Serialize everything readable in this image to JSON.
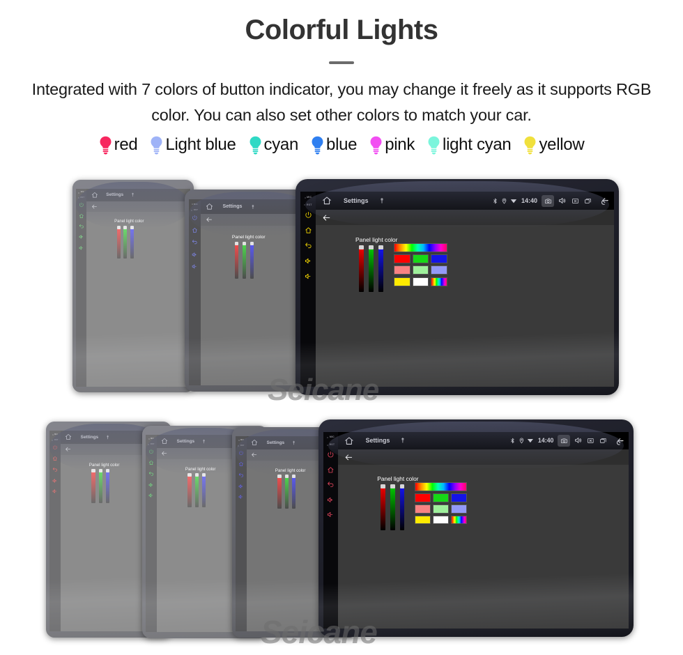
{
  "header": {
    "title": "Colorful Lights",
    "subtitle": "Integrated with 7 colors of button indicator, you may change it freely as it supports RGB color. You can also set other colors to match your car.",
    "divider_color": "#6b6b6b",
    "title_color": "#333333"
  },
  "legend": {
    "items": [
      {
        "label": "red",
        "color": "#f7275f",
        "icon": "bulb-icon"
      },
      {
        "label": "Light blue",
        "color": "#9fb3f7",
        "icon": "bulb-icon"
      },
      {
        "label": "cyan",
        "color": "#2fd9c5",
        "icon": "bulb-icon"
      },
      {
        "label": "blue",
        "color": "#2f7ff0",
        "icon": "bulb-icon"
      },
      {
        "label": "pink",
        "color": "#f24ef2",
        "icon": "bulb-icon"
      },
      {
        "label": "light cyan",
        "color": "#7bf5dc",
        "icon": "bulb-icon"
      },
      {
        "label": "yellow",
        "color": "#f0e03c",
        "icon": "bulb-icon"
      }
    ]
  },
  "watermark": {
    "text": "Seicane"
  },
  "screen_ui": {
    "status_bar": {
      "home_icon": "home-icon",
      "title": "Settings",
      "mic_icon": "microphone-icon",
      "bluetooth_icon": "bluetooth-icon",
      "location_icon": "location-pin-icon",
      "wifi_icon": "wifi-icon",
      "clock": "14:40",
      "camera_icon": "camera-icon",
      "volume_icon": "speaker-icon",
      "close_icon": "close-box-icon",
      "recents_icon": "recent-apps-icon",
      "back_icon": "back-arrow-icon"
    },
    "action_bar": {
      "back_icon": "arrow-left-icon"
    },
    "content": {
      "panel_label": "Panel light color",
      "sliders": [
        {
          "name": "red-channel",
          "color": "#ff0000",
          "value_pct": 100
        },
        {
          "name": "green-channel",
          "color": "#00d400",
          "value_pct": 100
        },
        {
          "name": "blue-channel",
          "color": "#1414ff",
          "value_pct": 100
        }
      ],
      "swatches": [
        {
          "name": "hue-spectrum",
          "type": "hue-wide"
        },
        {
          "name": "swatch-red",
          "color": "#ff0000"
        },
        {
          "name": "swatch-green",
          "color": "#16d816"
        },
        {
          "name": "swatch-blue",
          "color": "#1414e6"
        },
        {
          "name": "swatch-light-red",
          "color": "#f98282"
        },
        {
          "name": "swatch-light-green",
          "color": "#9ef09b"
        },
        {
          "name": "swatch-light-blue",
          "color": "#9399f7"
        },
        {
          "name": "swatch-yellow",
          "color": "#ffeb00"
        },
        {
          "name": "swatch-white",
          "color": "#ffffff"
        },
        {
          "name": "swatch-rainbow",
          "type": "hue-small"
        }
      ]
    },
    "hard_keys": {
      "mic_label": "MIC",
      "rst_label": "RST",
      "keys": [
        "power-icon",
        "home-icon",
        "back-icon",
        "volume-up-icon",
        "volume-down-icon"
      ]
    }
  },
  "devices": {
    "row_top": [
      {
        "name": "device-top-1",
        "key_color": "#2ecc40",
        "key_color_name": "green"
      },
      {
        "name": "device-top-2",
        "key_color": "#4a55e8",
        "key_color_name": "blue"
      },
      {
        "name": "device-top-3",
        "key_color": "#ffe100",
        "key_color_name": "yellow"
      }
    ],
    "row_bottom": [
      {
        "name": "device-bottom-1",
        "key_color": "#e61414",
        "key_color_name": "red"
      },
      {
        "name": "device-bottom-2",
        "key_color": "#13cc2e",
        "key_color_name": "green"
      },
      {
        "name": "device-bottom-3",
        "key_color": "#2222ee",
        "key_color_name": "blue"
      },
      {
        "name": "device-bottom-4",
        "key_color": "#e8465e",
        "key_color_name": "pink"
      }
    ]
  }
}
